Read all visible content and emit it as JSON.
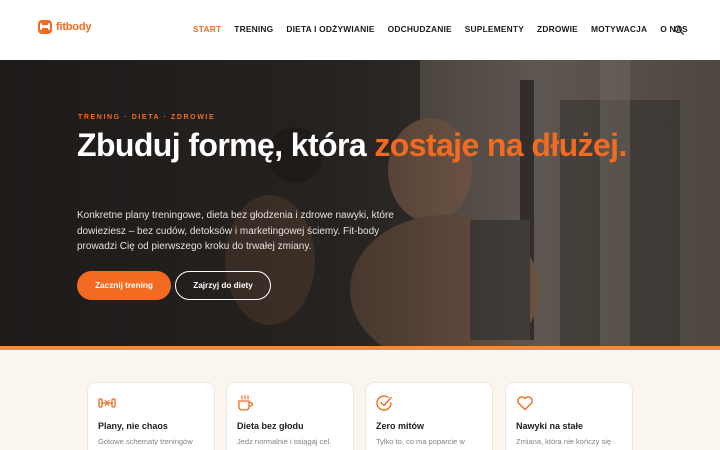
{
  "brand": {
    "name": "fitbody",
    "color": "#f26b21"
  },
  "nav": {
    "items": [
      {
        "label": "START",
        "active": true
      },
      {
        "label": "TRENING"
      },
      {
        "label": "DIETA I ODŻYWIANIE"
      },
      {
        "label": "ODCHUDZANIE"
      },
      {
        "label": "SUPLEMENTY"
      },
      {
        "label": "ZDROWIE"
      },
      {
        "label": "MOTYWACJA"
      },
      {
        "label": "O NAS"
      }
    ],
    "search_icon": "search-icon"
  },
  "hero": {
    "eyebrow": "TRENING · DIETA · ZDROWIE",
    "headline_main": "Zbuduj formę, która ",
    "headline_accent": "zostaje na dłużej.",
    "lead": "Konkretne plany treningowe, dieta bez głodzenia i zdrowe nawyki, które dowieziesz – bez cudów, detoksów i marketingowej ściemy. Fit-body prowadzi Cię od pierwszego kroku do trwałej zmiany.",
    "primary_button": "Zacznij trening",
    "secondary_button": "Zajrzyj do diety"
  },
  "features": [
    {
      "icon": "dumbbell-icon",
      "title": "Plany, nie chaos",
      "desc": "Gotowe schematy treningów"
    },
    {
      "icon": "cup-icon",
      "title": "Dieta bez głodu",
      "desc": "Jedz normalnie i osiągaj cel."
    },
    {
      "icon": "check-circle-icon",
      "title": "Zero mitów",
      "desc": "Tylko to, co ma poparcie w"
    },
    {
      "icon": "heart-icon",
      "title": "Nawyki na stałe",
      "desc": "Zmiana, która nie kończy się"
    }
  ],
  "colors": {
    "accent": "#f26b21",
    "hero_bar": "#f08a3c",
    "section_bg": "#fbf5ef"
  }
}
